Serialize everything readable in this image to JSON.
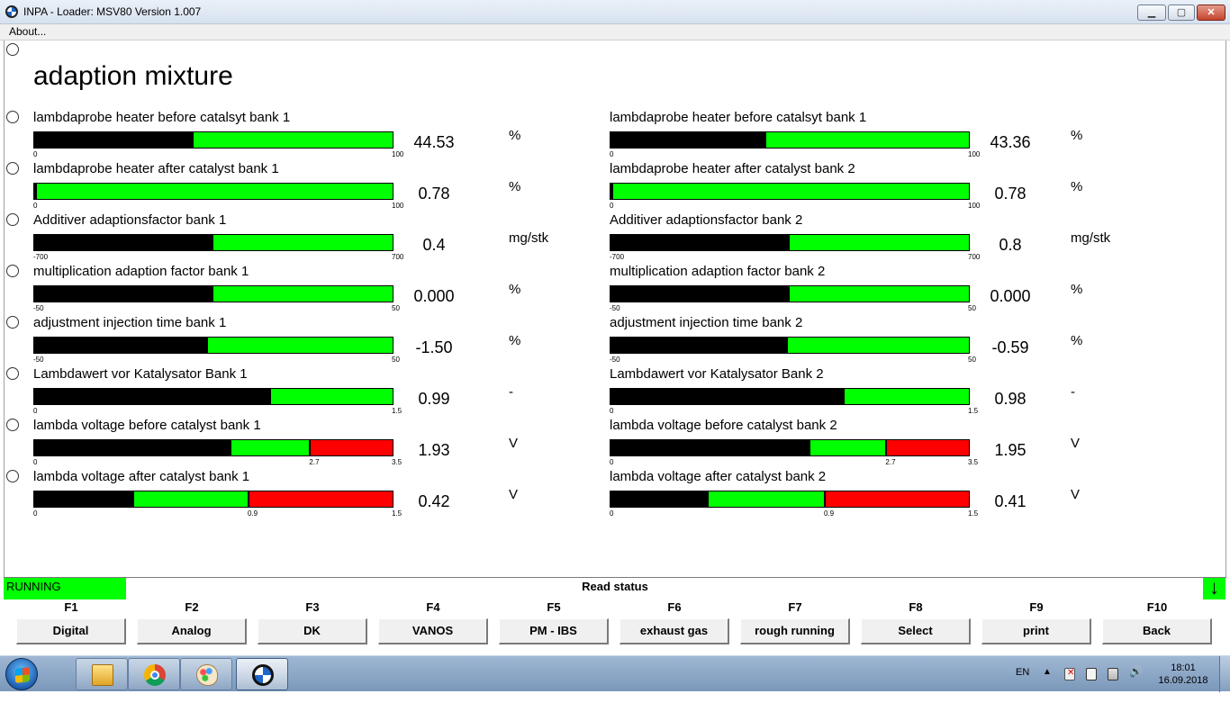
{
  "window": {
    "title": "INPA - Loader:  MSV80 Version 1.007"
  },
  "menu": {
    "about": "About..."
  },
  "page": {
    "title": "adaption mixture"
  },
  "colors": {
    "bar_green": "#00ff00",
    "bar_red": "#ff0000",
    "bar_fill": "#000000",
    "status_green": "#00ff00"
  },
  "rows": [
    {
      "left": {
        "label": "lambdaprobe heater before catalsyt bank 1",
        "value": "44.53",
        "unit": "%",
        "ticks": [
          "0",
          "100"
        ],
        "fill_fraction": 0.445,
        "red_from": null
      },
      "right": {
        "label": "lambdaprobe heater before catalsyt bank 1",
        "value": "43.36",
        "unit": "%",
        "ticks": [
          "0",
          "100"
        ],
        "fill_fraction": 0.434,
        "red_from": null
      }
    },
    {
      "left": {
        "label": "lambdaprobe heater after catalyst bank 1",
        "value": "0.78",
        "unit": "%",
        "ticks": [
          "0",
          "100"
        ],
        "fill_fraction": 0.008,
        "red_from": null
      },
      "right": {
        "label": "lambdaprobe heater after catalyst bank 2",
        "value": "0.78",
        "unit": "%",
        "ticks": [
          "0",
          "100"
        ],
        "fill_fraction": 0.008,
        "red_from": null
      }
    },
    {
      "left": {
        "label": "Additiver adaptionsfactor bank 1",
        "value": "0.4",
        "unit": "mg/stk",
        "ticks": [
          "-700",
          "700"
        ],
        "fill_fraction": 0.5,
        "red_from": null
      },
      "right": {
        "label": "Additiver adaptionsfactor bank 2",
        "value": "0.8",
        "unit": "mg/stk",
        "ticks": [
          "-700",
          "700"
        ],
        "fill_fraction": 0.5,
        "red_from": null
      }
    },
    {
      "left": {
        "label": "multiplication adaption factor bank 1",
        "value": "0.000",
        "unit": "%",
        "ticks": [
          "-50",
          "50"
        ],
        "fill_fraction": 0.5,
        "red_from": null
      },
      "right": {
        "label": "multiplication adaption factor bank 2",
        "value": "0.000",
        "unit": "%",
        "ticks": [
          "-50",
          "50"
        ],
        "fill_fraction": 0.5,
        "red_from": null
      }
    },
    {
      "left": {
        "label": "adjustment injection time bank 1",
        "value": "-1.50",
        "unit": "%",
        "ticks": [
          "-50",
          "50"
        ],
        "fill_fraction": 0.485,
        "red_from": null
      },
      "right": {
        "label": "adjustment injection time bank 2",
        "value": "-0.59",
        "unit": "%",
        "ticks": [
          "-50",
          "50"
        ],
        "fill_fraction": 0.494,
        "red_from": null
      }
    },
    {
      "left": {
        "label": "Lambdawert vor Katalysator Bank 1",
        "value": "0.99",
        "unit": "-",
        "ticks": [
          "0",
          "1.5"
        ],
        "fill_fraction": 0.66,
        "red_from": null
      },
      "right": {
        "label": "Lambdawert vor Katalysator Bank 2",
        "value": "0.98",
        "unit": "-",
        "ticks": [
          "0",
          "1.5"
        ],
        "fill_fraction": 0.653,
        "red_from": null
      }
    },
    {
      "left": {
        "label": "lambda voltage before catalyst bank 1",
        "value": "1.93",
        "unit": "V",
        "ticks": [
          "0",
          "2.7",
          "3.5"
        ],
        "tick_pos": [
          0,
          0.771,
          1
        ],
        "fill_fraction": 0.551,
        "red_from": 0.771
      },
      "right": {
        "label": "lambda voltage before catalyst bank 2",
        "value": "1.95",
        "unit": "V",
        "ticks": [
          "0",
          "2.7",
          "3.5"
        ],
        "tick_pos": [
          0,
          0.771,
          1
        ],
        "fill_fraction": 0.557,
        "red_from": 0.771
      }
    },
    {
      "left": {
        "label": "lambda voltage after catalyst bank 1",
        "value": "0.42",
        "unit": "V",
        "ticks": [
          "0",
          "0.9",
          "1.5"
        ],
        "tick_pos": [
          0,
          0.6,
          1
        ],
        "fill_fraction": 0.28,
        "red_from": 0.6
      },
      "right": {
        "label": "lambda voltage after catalyst bank 2",
        "value": "0.41",
        "unit": "V",
        "ticks": [
          "0",
          "0.9",
          "1.5"
        ],
        "tick_pos": [
          0,
          0.6,
          1
        ],
        "fill_fraction": 0.273,
        "red_from": 0.6
      }
    }
  ],
  "status": {
    "running": "RUNNING",
    "text": "Read status"
  },
  "fkeys": [
    {
      "key": "F1",
      "label": "Digital"
    },
    {
      "key": "F2",
      "label": "Analog"
    },
    {
      "key": "F3",
      "label": "DK"
    },
    {
      "key": "F4",
      "label": "VANOS"
    },
    {
      "key": "F5",
      "label": "PM - IBS"
    },
    {
      "key": "F6",
      "label": "exhaust gas"
    },
    {
      "key": "F7",
      "label": "rough running"
    },
    {
      "key": "F8",
      "label": "Select"
    },
    {
      "key": "F9",
      "label": "print"
    },
    {
      "key": "F10",
      "label": "Back"
    }
  ],
  "taskbar": {
    "apps": [
      "explorer-icon",
      "chrome-icon",
      "paint-icon",
      "bmw-inpa-icon"
    ],
    "lang": "EN",
    "time": "18:01",
    "date": "16.09.2018"
  }
}
